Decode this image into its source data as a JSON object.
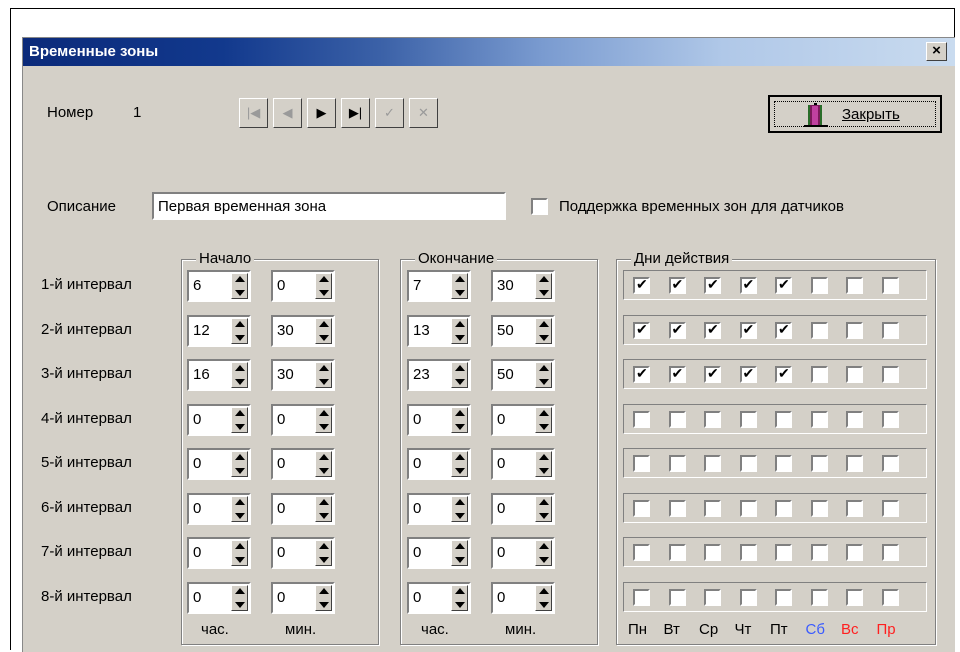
{
  "window": {
    "title": "Временные зоны",
    "close_glyph": "×"
  },
  "header": {
    "number_label": "Номер",
    "number_value": "1",
    "close_button_label": "Закрыть"
  },
  "nav": [
    {
      "name": "first-record-button",
      "glyph": "|◀",
      "enabled": false
    },
    {
      "name": "prev-record-button",
      "glyph": "◀",
      "enabled": false
    },
    {
      "name": "next-record-button",
      "glyph": "▶",
      "enabled": true
    },
    {
      "name": "last-record-button",
      "glyph": "▶|",
      "enabled": true
    },
    {
      "name": "post-button",
      "glyph": "✓",
      "enabled": false
    },
    {
      "name": "cancel-edit-button",
      "glyph": "✕",
      "enabled": false
    }
  ],
  "description": {
    "label": "Описание",
    "value": "Первая временная зона",
    "sensor_support_label": "Поддержка временных зон для датчиков",
    "sensor_support_checked": false
  },
  "groups": {
    "start": "Начало",
    "end": "Окончание",
    "days": "Дни действия"
  },
  "units": {
    "hours": "час.",
    "minutes": "мин."
  },
  "days_labels": [
    {
      "text": "Пн",
      "color": "#000000"
    },
    {
      "text": "Вт",
      "color": "#000000"
    },
    {
      "text": "Ср",
      "color": "#000000"
    },
    {
      "text": "Чт",
      "color": "#000000"
    },
    {
      "text": "Пт",
      "color": "#000000"
    },
    {
      "text": "Сб",
      "color": "#3a5bff"
    },
    {
      "text": "Вс",
      "color": "#ff2020"
    },
    {
      "text": "Пр",
      "color": "#ff2020"
    }
  ],
  "intervals": [
    {
      "label": "1-й интервал",
      "start_h": "6",
      "start_m": "0",
      "end_h": "7",
      "end_m": "30",
      "days": [
        1,
        1,
        1,
        1,
        1,
        0,
        0,
        0
      ]
    },
    {
      "label": "2-й интервал",
      "start_h": "12",
      "start_m": "30",
      "end_h": "13",
      "end_m": "50",
      "days": [
        1,
        1,
        1,
        1,
        1,
        0,
        0,
        0
      ]
    },
    {
      "label": "3-й интервал",
      "start_h": "16",
      "start_m": "30",
      "end_h": "23",
      "end_m": "50",
      "days": [
        1,
        1,
        1,
        1,
        1,
        0,
        0,
        0
      ]
    },
    {
      "label": "4-й интервал",
      "start_h": "0",
      "start_m": "0",
      "end_h": "0",
      "end_m": "0",
      "days": [
        0,
        0,
        0,
        0,
        0,
        0,
        0,
        0
      ]
    },
    {
      "label": "5-й интервал",
      "start_h": "0",
      "start_m": "0",
      "end_h": "0",
      "end_m": "0",
      "days": [
        0,
        0,
        0,
        0,
        0,
        0,
        0,
        0
      ]
    },
    {
      "label": "6-й интервал",
      "start_h": "0",
      "start_m": "0",
      "end_h": "0",
      "end_m": "0",
      "days": [
        0,
        0,
        0,
        0,
        0,
        0,
        0,
        0
      ]
    },
    {
      "label": "7-й интервал",
      "start_h": "0",
      "start_m": "0",
      "end_h": "0",
      "end_m": "0",
      "days": [
        0,
        0,
        0,
        0,
        0,
        0,
        0,
        0
      ]
    },
    {
      "label": "8-й интервал",
      "start_h": "0",
      "start_m": "0",
      "end_h": "0",
      "end_m": "0",
      "days": [
        0,
        0,
        0,
        0,
        0,
        0,
        0,
        0
      ]
    }
  ]
}
